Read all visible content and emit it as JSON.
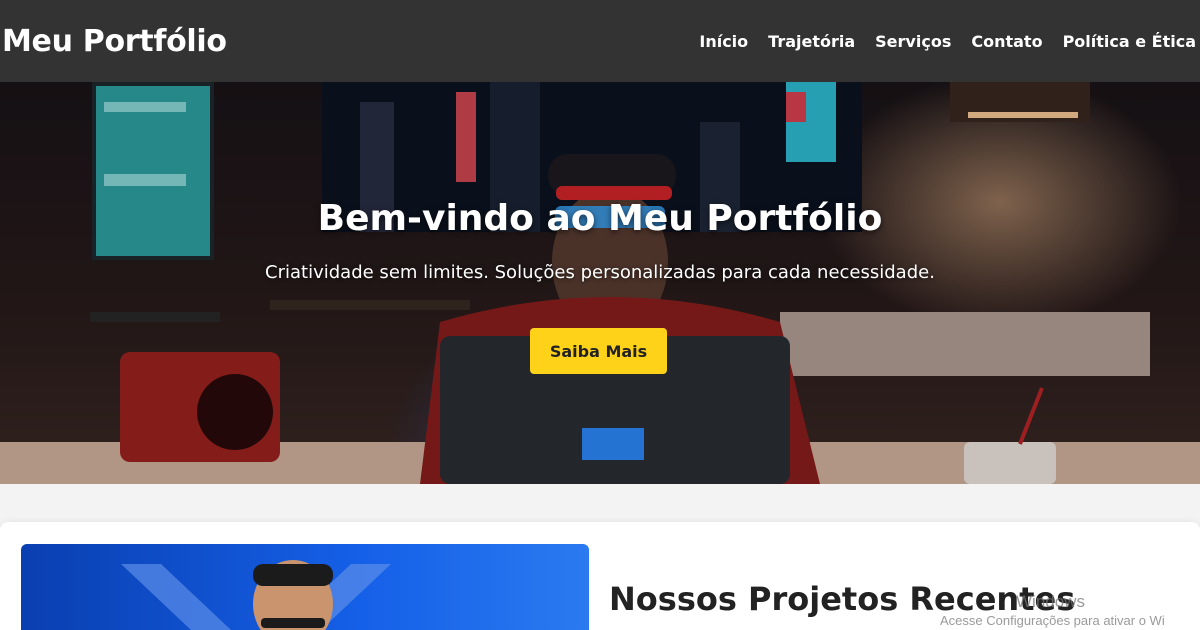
{
  "header": {
    "brand": "Meu Portfólio",
    "nav": [
      "Início",
      "Trajetória",
      "Serviços",
      "Contato",
      "Política e Ética"
    ]
  },
  "hero": {
    "title": "Bem-vindo ao Meu Portfólio",
    "subtitle": "Criatividade sem limites. Soluções personalizadas para cada necessidade.",
    "cta_label": "Saiba Mais"
  },
  "projects": {
    "title": "Nossos Projetos Recentes"
  },
  "watermark": {
    "line1": "Windows",
    "line2": "Acesse Configurações para ativar o Wi"
  },
  "colors": {
    "header_bg": "#333333",
    "cta_bg": "#ffd21a",
    "page_bg": "#f3f3f3"
  }
}
